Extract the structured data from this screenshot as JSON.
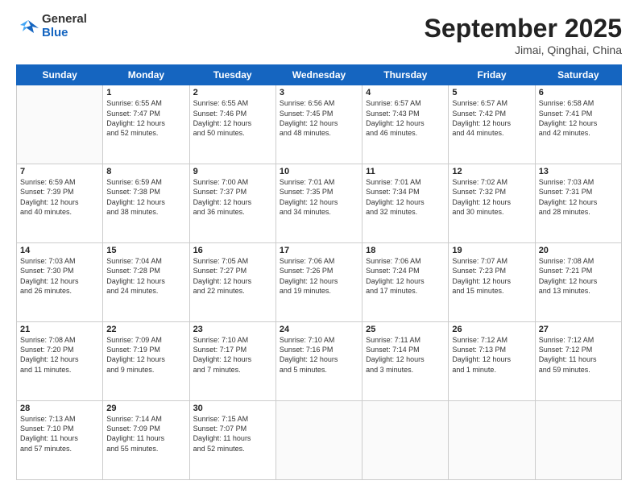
{
  "header": {
    "logo_general": "General",
    "logo_blue": "Blue",
    "month": "September 2025",
    "location": "Jimai, Qinghai, China"
  },
  "weekdays": [
    "Sunday",
    "Monday",
    "Tuesday",
    "Wednesday",
    "Thursday",
    "Friday",
    "Saturday"
  ],
  "weeks": [
    [
      {
        "day": "",
        "text": ""
      },
      {
        "day": "1",
        "text": "Sunrise: 6:55 AM\nSunset: 7:47 PM\nDaylight: 12 hours\nand 52 minutes."
      },
      {
        "day": "2",
        "text": "Sunrise: 6:55 AM\nSunset: 7:46 PM\nDaylight: 12 hours\nand 50 minutes."
      },
      {
        "day": "3",
        "text": "Sunrise: 6:56 AM\nSunset: 7:45 PM\nDaylight: 12 hours\nand 48 minutes."
      },
      {
        "day": "4",
        "text": "Sunrise: 6:57 AM\nSunset: 7:43 PM\nDaylight: 12 hours\nand 46 minutes."
      },
      {
        "day": "5",
        "text": "Sunrise: 6:57 AM\nSunset: 7:42 PM\nDaylight: 12 hours\nand 44 minutes."
      },
      {
        "day": "6",
        "text": "Sunrise: 6:58 AM\nSunset: 7:41 PM\nDaylight: 12 hours\nand 42 minutes."
      }
    ],
    [
      {
        "day": "7",
        "text": "Sunrise: 6:59 AM\nSunset: 7:39 PM\nDaylight: 12 hours\nand 40 minutes."
      },
      {
        "day": "8",
        "text": "Sunrise: 6:59 AM\nSunset: 7:38 PM\nDaylight: 12 hours\nand 38 minutes."
      },
      {
        "day": "9",
        "text": "Sunrise: 7:00 AM\nSunset: 7:37 PM\nDaylight: 12 hours\nand 36 minutes."
      },
      {
        "day": "10",
        "text": "Sunrise: 7:01 AM\nSunset: 7:35 PM\nDaylight: 12 hours\nand 34 minutes."
      },
      {
        "day": "11",
        "text": "Sunrise: 7:01 AM\nSunset: 7:34 PM\nDaylight: 12 hours\nand 32 minutes."
      },
      {
        "day": "12",
        "text": "Sunrise: 7:02 AM\nSunset: 7:32 PM\nDaylight: 12 hours\nand 30 minutes."
      },
      {
        "day": "13",
        "text": "Sunrise: 7:03 AM\nSunset: 7:31 PM\nDaylight: 12 hours\nand 28 minutes."
      }
    ],
    [
      {
        "day": "14",
        "text": "Sunrise: 7:03 AM\nSunset: 7:30 PM\nDaylight: 12 hours\nand 26 minutes."
      },
      {
        "day": "15",
        "text": "Sunrise: 7:04 AM\nSunset: 7:28 PM\nDaylight: 12 hours\nand 24 minutes."
      },
      {
        "day": "16",
        "text": "Sunrise: 7:05 AM\nSunset: 7:27 PM\nDaylight: 12 hours\nand 22 minutes."
      },
      {
        "day": "17",
        "text": "Sunrise: 7:06 AM\nSunset: 7:26 PM\nDaylight: 12 hours\nand 19 minutes."
      },
      {
        "day": "18",
        "text": "Sunrise: 7:06 AM\nSunset: 7:24 PM\nDaylight: 12 hours\nand 17 minutes."
      },
      {
        "day": "19",
        "text": "Sunrise: 7:07 AM\nSunset: 7:23 PM\nDaylight: 12 hours\nand 15 minutes."
      },
      {
        "day": "20",
        "text": "Sunrise: 7:08 AM\nSunset: 7:21 PM\nDaylight: 12 hours\nand 13 minutes."
      }
    ],
    [
      {
        "day": "21",
        "text": "Sunrise: 7:08 AM\nSunset: 7:20 PM\nDaylight: 12 hours\nand 11 minutes."
      },
      {
        "day": "22",
        "text": "Sunrise: 7:09 AM\nSunset: 7:19 PM\nDaylight: 12 hours\nand 9 minutes."
      },
      {
        "day": "23",
        "text": "Sunrise: 7:10 AM\nSunset: 7:17 PM\nDaylight: 12 hours\nand 7 minutes."
      },
      {
        "day": "24",
        "text": "Sunrise: 7:10 AM\nSunset: 7:16 PM\nDaylight: 12 hours\nand 5 minutes."
      },
      {
        "day": "25",
        "text": "Sunrise: 7:11 AM\nSunset: 7:14 PM\nDaylight: 12 hours\nand 3 minutes."
      },
      {
        "day": "26",
        "text": "Sunrise: 7:12 AM\nSunset: 7:13 PM\nDaylight: 12 hours\nand 1 minute."
      },
      {
        "day": "27",
        "text": "Sunrise: 7:12 AM\nSunset: 7:12 PM\nDaylight: 11 hours\nand 59 minutes."
      }
    ],
    [
      {
        "day": "28",
        "text": "Sunrise: 7:13 AM\nSunset: 7:10 PM\nDaylight: 11 hours\nand 57 minutes."
      },
      {
        "day": "29",
        "text": "Sunrise: 7:14 AM\nSunset: 7:09 PM\nDaylight: 11 hours\nand 55 minutes."
      },
      {
        "day": "30",
        "text": "Sunrise: 7:15 AM\nSunset: 7:07 PM\nDaylight: 11 hours\nand 52 minutes."
      },
      {
        "day": "",
        "text": ""
      },
      {
        "day": "",
        "text": ""
      },
      {
        "day": "",
        "text": ""
      },
      {
        "day": "",
        "text": ""
      }
    ]
  ]
}
